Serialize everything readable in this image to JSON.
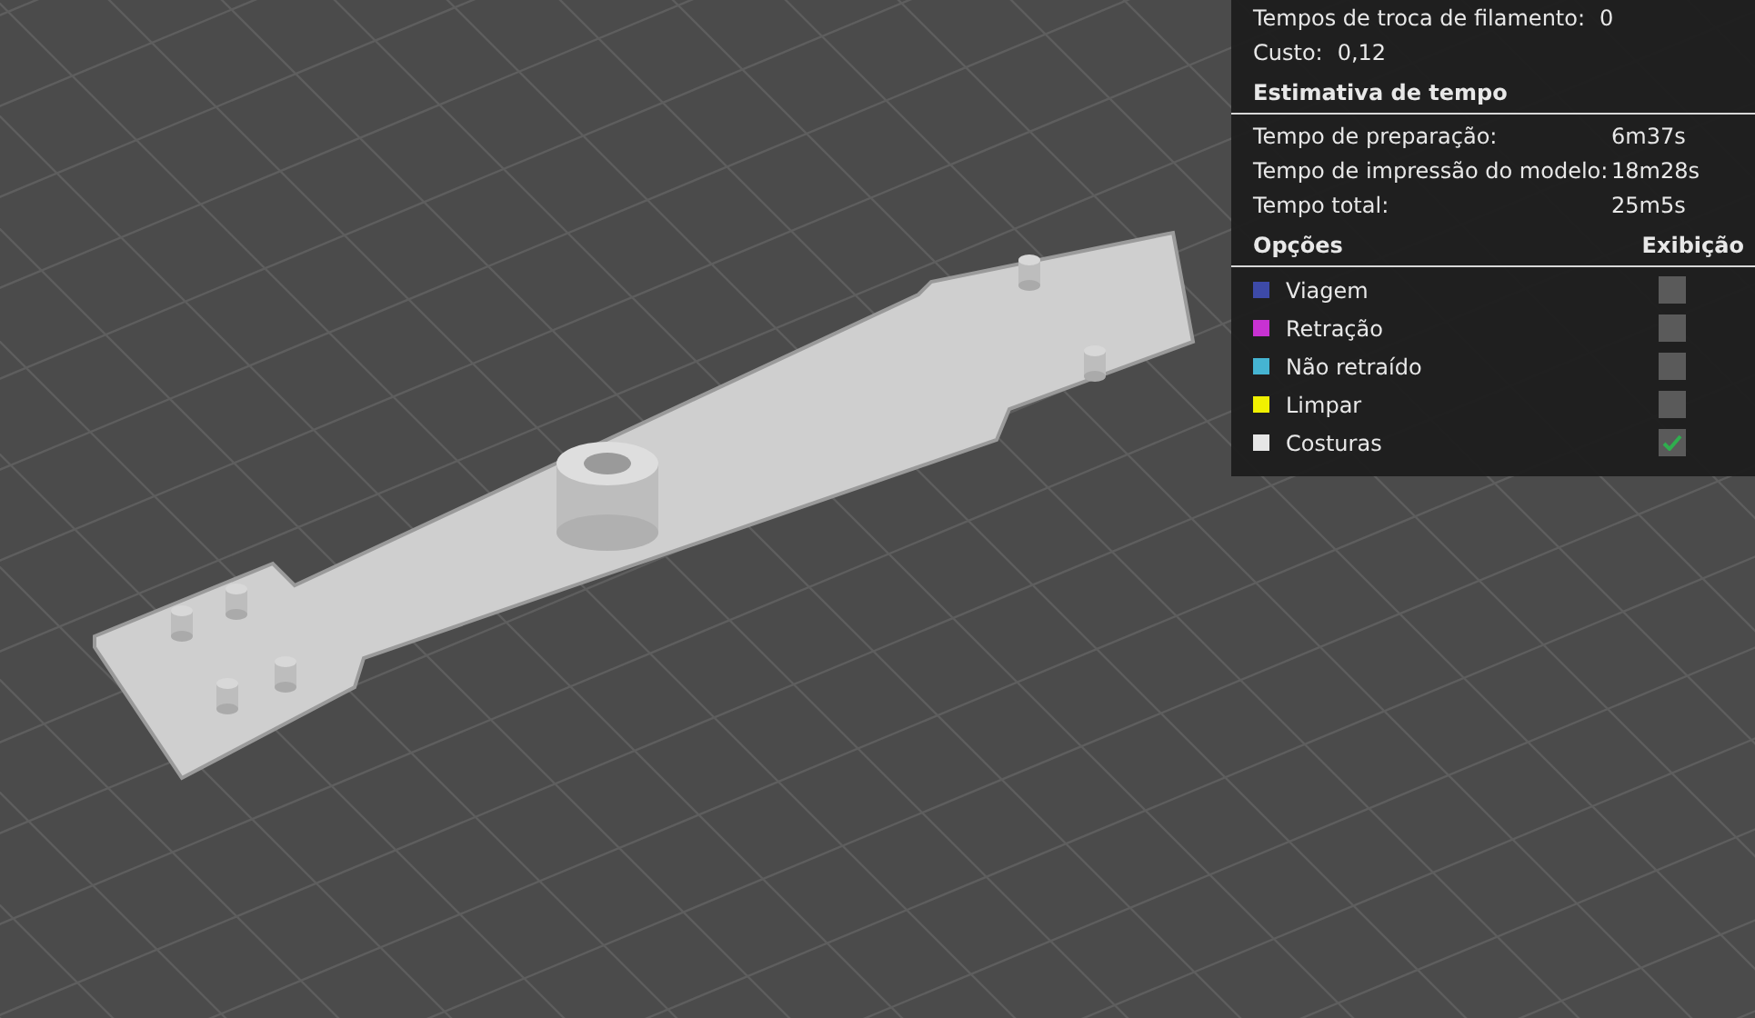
{
  "summary": [
    {
      "label": "Tempos de troca de filamento:",
      "value": "0"
    },
    {
      "label": "Custo:",
      "value": "0,12"
    }
  ],
  "time_estimate": {
    "title": "Estimativa de tempo",
    "rows": [
      {
        "label": "Tempo de preparação:",
        "value": "6m37s"
      },
      {
        "label": "Tempo de impressão do modelo:",
        "value": "18m28s"
      },
      {
        "label": "Tempo total:",
        "value": "25m5s"
      }
    ]
  },
  "options": {
    "column_1": "Opções",
    "column_2": "Exibição",
    "items": [
      {
        "label": "Viagem",
        "color": "#3d4aa8",
        "checked": false
      },
      {
        "label": "Retração",
        "color": "#c832d2",
        "checked": false
      },
      {
        "label": "Não retraído",
        "color": "#45b4d2",
        "checked": false
      },
      {
        "label": "Limpar",
        "color": "#f0f000",
        "checked": false
      },
      {
        "label": "Costuras",
        "color": "#e6e6e6",
        "checked": true
      }
    ]
  }
}
